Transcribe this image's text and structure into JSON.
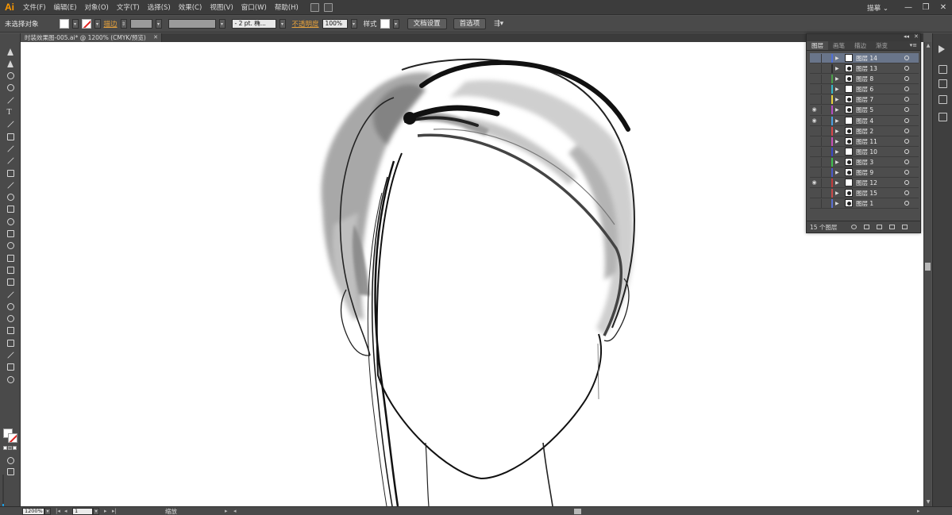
{
  "app": {
    "logo": "Ai",
    "menu": [
      "文件(F)",
      "编辑(E)",
      "对象(O)",
      "文字(T)",
      "选择(S)",
      "效果(C)",
      "视图(V)",
      "窗口(W)",
      "帮助(H)"
    ],
    "workspace": "描摹",
    "workspace_caret": "⌄",
    "window_buttons": [
      "—",
      "❐",
      "✕"
    ]
  },
  "control_bar": {
    "selection_status": "未选择对象",
    "stroke_label": "描边",
    "stroke_profile": "- 2 pt. 椭...",
    "opacity_label": "不透明度",
    "opacity_value": "100%",
    "style_label": "样式",
    "doc_setup_button": "文档设置",
    "preferences_button": "首选项"
  },
  "document_tab": {
    "title": "时装效果图-005.ai* @ 1200% (CMYK/预览)",
    "close": "✕"
  },
  "status_bar": {
    "zoom": "1200%",
    "artboard": "1",
    "tool_name": "缩放"
  },
  "layers_panel": {
    "tabs": [
      "图层",
      "画笔",
      "描边",
      "渐变"
    ],
    "active_tab": "图层",
    "collapse": "◂◂",
    "close": "✕",
    "menu": "▾≡",
    "count_label": "15 个图层",
    "layers": [
      {
        "name": "图层 14",
        "color": "#4f6fd8",
        "visible": false,
        "selected": true
      },
      {
        "name": "图层 13",
        "color": "#2d2d2d",
        "visible": false,
        "selected": false
      },
      {
        "name": "图层 8",
        "color": "#4aa049",
        "visible": false,
        "selected": false
      },
      {
        "name": "图层 6",
        "color": "#35b8c8",
        "visible": false,
        "selected": false
      },
      {
        "name": "图层 7",
        "color": "#e7d23c",
        "visible": false,
        "selected": false
      },
      {
        "name": "图层 5",
        "color": "#b64cc2",
        "visible": true,
        "selected": false
      },
      {
        "name": "图层 4",
        "color": "#4aa0e0",
        "visible": true,
        "selected": false
      },
      {
        "name": "图层 2",
        "color": "#d8464a",
        "visible": false,
        "selected": false
      },
      {
        "name": "图层 11",
        "color": "#c94fb5",
        "visible": false,
        "selected": false
      },
      {
        "name": "图层 10",
        "color": "#3c48c6",
        "visible": false,
        "selected": false
      },
      {
        "name": "图层 3",
        "color": "#3fbf4f",
        "visible": false,
        "selected": false
      },
      {
        "name": "图层 9",
        "color": "#4b59c9",
        "visible": false,
        "selected": false
      },
      {
        "name": "图层 12",
        "color": "#c33c3c",
        "visible": true,
        "selected": false
      },
      {
        "name": "图层 15",
        "color": "#c94a4a",
        "visible": false,
        "selected": false
      },
      {
        "name": "图层 1",
        "color": "#5a6fd0",
        "visible": false,
        "selected": false
      }
    ]
  },
  "tools": [
    "selection-icon",
    "direct-selection-icon",
    "magic-wand-icon",
    "lasso-icon",
    "pen-icon",
    "type-icon",
    "line-segment-icon",
    "rectangle-icon",
    "paintbrush-icon",
    "pencil-icon",
    "blob-brush-icon",
    "eraser-icon",
    "rotate-icon",
    "scale-icon",
    "warp-icon",
    "free-transform-icon",
    "shape-builder-icon",
    "perspective-grid-icon",
    "mesh-icon",
    "gradient-icon",
    "eyedropper-icon",
    "blend-icon",
    "symbol-sprayer-icon",
    "column-graph-icon",
    "artboard-icon",
    "slice-icon",
    "hand-icon",
    "zoom-icon"
  ]
}
